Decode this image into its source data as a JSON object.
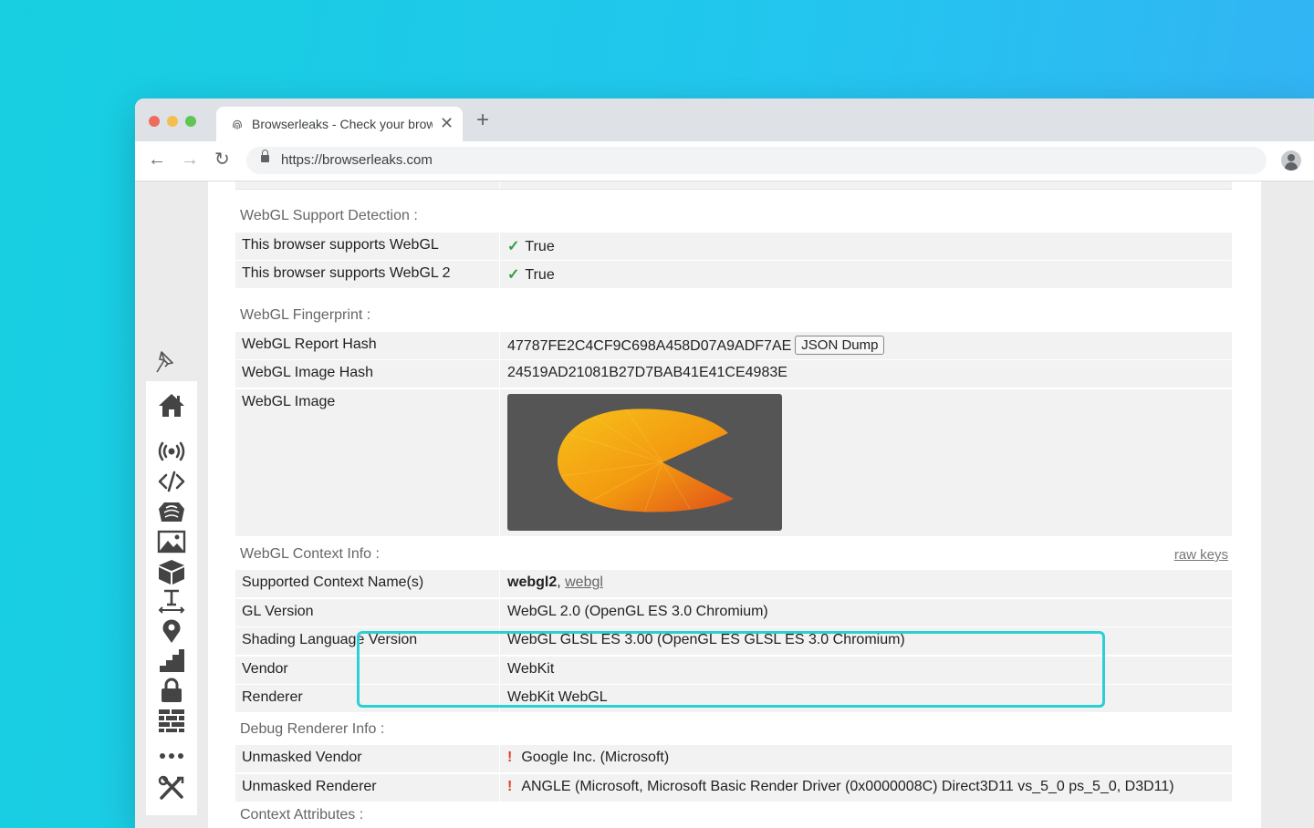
{
  "browser": {
    "tab_title": "Browserleaks - Check your browser",
    "url": "https://browserleaks.com"
  },
  "sections": {
    "support": "WebGL Support Detection :",
    "fingerprint": "WebGL Fingerprint :",
    "context": "WebGL Context Info :",
    "debug": "Debug Renderer Info :",
    "attributes": "Context Attributes :"
  },
  "raw_keys": "raw keys",
  "support_rows": [
    {
      "label": "This browser supports WebGL",
      "value": "True"
    },
    {
      "label": "This browser supports WebGL 2",
      "value": "True"
    }
  ],
  "fingerprint_rows": {
    "report_hash_label": "WebGL Report Hash",
    "report_hash_value": "47787FE2C4CF9C698A458D07A9ADF7AE",
    "json_dump": "JSON Dump",
    "image_hash_label": "WebGL Image Hash",
    "image_hash_value": "24519AD21081B27D7BAB41E41CE4983E",
    "image_label": "WebGL Image"
  },
  "context_rows": {
    "names_label": "Supported Context Name(s)",
    "names_primary": "webgl2",
    "names_sep": ", ",
    "names_secondary": "webgl",
    "version_label": "GL Version",
    "version_value": "WebGL 2.0 (OpenGL ES 3.0 Chromium)",
    "glsl_label": "Shading Language Version",
    "glsl_value": "WebGL GLSL ES 3.00 (OpenGL ES GLSL ES 3.0 Chromium)",
    "vendor_label": "Vendor",
    "vendor_value": "WebKit",
    "renderer_label": "Renderer",
    "renderer_value": "WebKit WebGL"
  },
  "debug_rows": {
    "vendor_label": "Unmasked Vendor",
    "vendor_value": "Google Inc. (Microsoft)",
    "renderer_label": "Unmasked Renderer",
    "renderer_value": "ANGLE (Microsoft, Microsoft Basic Render Driver (0x0000008C) Direct3D11 vs_5_0 ps_5_0, D3D11)"
  },
  "symbols": {
    "check": "✓",
    "warn": "!",
    "close": "✕",
    "plus": "+",
    "back": "←",
    "forward": "→",
    "reload": "↻",
    "star": "☆"
  },
  "colors": {
    "highlight": "#2ccfd6",
    "check": "#2f9e48",
    "warn": "#e0412b",
    "image_bg": "#555555"
  },
  "sidebar_icons": [
    "pin-icon",
    "home-icon",
    "broadcast-icon",
    "code-icon",
    "fingerprint-icon",
    "image-icon",
    "cube-icon",
    "text-resize-icon",
    "location-icon",
    "stairs-icon",
    "lock-icon",
    "firewall-icon",
    "more-icon",
    "tools-icon"
  ]
}
